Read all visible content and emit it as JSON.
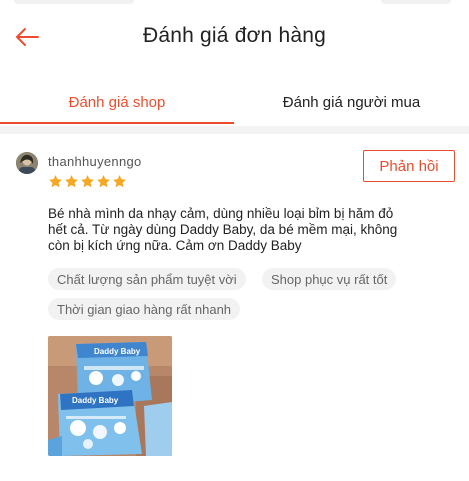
{
  "header": {
    "title": "Đánh giá đơn hàng",
    "back_icon": "arrow-left-icon"
  },
  "tabs": [
    {
      "label": "Đánh giá shop",
      "active": true
    },
    {
      "label": "Đánh giá người mua",
      "active": false
    }
  ],
  "review": {
    "username": "thanhhuyenngo",
    "rating": 5,
    "reply_label": "Phản hồi",
    "comment_lines": [
      "Bé nhà mình da nhạy cảm, dùng nhiều loại bỉm bị hăm đỏ",
      "hết cả. Từ ngày dùng Daddy Baby, da bé mềm mại, không",
      "còn bị kích ứng nữa. Cảm ơn Daddy Baby"
    ],
    "tags": [
      "Chất lượng sản phẩm tuyệt vời",
      "Shop phục vụ rất tốt",
      "Thời gian giao hàng rất nhanh"
    ],
    "photo": {
      "brand_text": "Daddy Baby"
    }
  },
  "colors": {
    "accent": "#ee4d2d",
    "star": "#f5a623",
    "tag_bg": "#f2f2f2"
  }
}
